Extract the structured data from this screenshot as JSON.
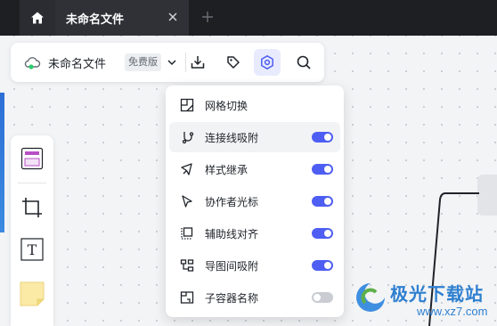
{
  "tabs": {
    "home_icon": "home-icon",
    "active_title": "未命名文件",
    "close_icon": "close-icon",
    "add_icon": "plus-icon"
  },
  "toolbar": {
    "file_name": "未命名文件",
    "plan_badge": "免费版",
    "buttons": [
      "download-icon",
      "tag-icon",
      "gear-icon",
      "search-icon"
    ],
    "active_button": "settings"
  },
  "settings_menu": {
    "items": [
      {
        "label": "网格切换",
        "icon": "grid-toggle-icon",
        "has_toggle": false
      },
      {
        "label": "连接线吸附",
        "icon": "connector-snap-icon",
        "has_toggle": true,
        "enabled": true
      },
      {
        "label": "样式继承",
        "icon": "style-inherit-icon",
        "has_toggle": true,
        "enabled": true
      },
      {
        "label": "协作者光标",
        "icon": "cursor-icon",
        "has_toggle": true,
        "enabled": true
      },
      {
        "label": "辅助线对齐",
        "icon": "guide-align-icon",
        "has_toggle": true,
        "enabled": true
      },
      {
        "label": "导图间吸附",
        "icon": "mindmap-snap-icon",
        "has_toggle": true,
        "enabled": true
      },
      {
        "label": "子容器名称",
        "icon": "container-name-icon",
        "has_toggle": true,
        "enabled": false
      }
    ]
  },
  "shape_panel": {
    "items": [
      "frame-icon",
      "crop-icon",
      "text-icon",
      "sticky-note-icon"
    ],
    "text_tool_glyph": "T"
  },
  "colors": {
    "accent": "#4e5ef2",
    "tabbar": "#1d1f23",
    "toggle_off": "#c9ccd2"
  },
  "watermark": {
    "text": "极光下载站",
    "url": "www.xz7.com"
  }
}
